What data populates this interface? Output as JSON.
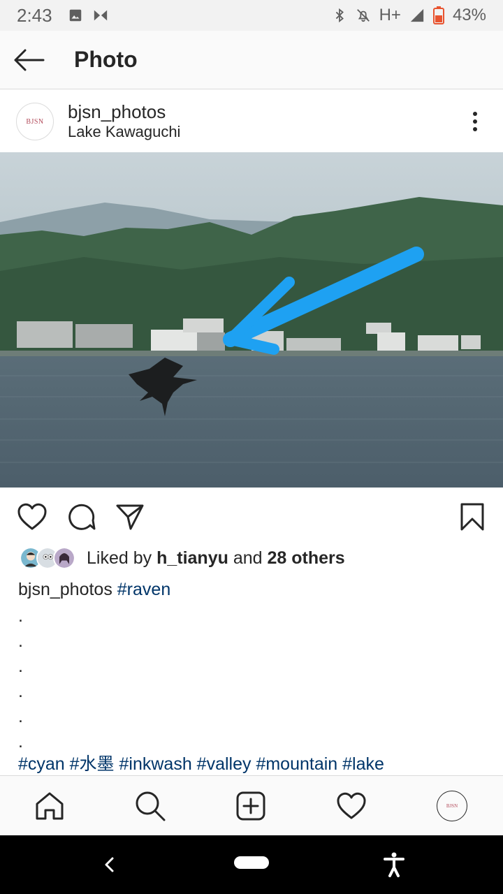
{
  "status_bar": {
    "time": "2:43",
    "network": "H+",
    "battery": "43%",
    "icons": [
      "image-icon",
      "bowtie-icon",
      "bluetooth-icon",
      "notifications-off-icon",
      "signal-icon",
      "battery-icon"
    ]
  },
  "app_bar": {
    "title": "Photo",
    "back_icon": "back-arrow-icon"
  },
  "post": {
    "avatar_text": "BJSN",
    "username": "bjsn_photos",
    "location": "Lake Kawaguchi",
    "more_icon": "more-vertical-icon",
    "photo_alt": "raven",
    "actions": [
      "heart-icon",
      "comment-icon",
      "share-icon",
      "bookmark-icon"
    ],
    "likes": {
      "prefix": "Liked by",
      "user": "h_tianyu",
      "middle": "and",
      "others": "28 others"
    },
    "caption": {
      "username": "bjsn_photos",
      "tag": "#raven",
      "dots": [
        ".",
        ".",
        ".",
        ".",
        ".",
        "."
      ],
      "tags": "#cyan #水墨 #inkwash #valley #mountain #lake"
    }
  },
  "bottom_nav": {
    "items": [
      "home-icon",
      "search-icon",
      "add-post-icon",
      "activity-heart-icon",
      "profile-avatar"
    ],
    "avatar_text": "BJSN"
  },
  "system_nav": {
    "items": [
      "back-icon",
      "home-pill",
      "accessibility-icon"
    ]
  },
  "colors": {
    "hashtag": "#003569",
    "arrow_overlay": "#1ea1f2",
    "text": "#262626"
  }
}
